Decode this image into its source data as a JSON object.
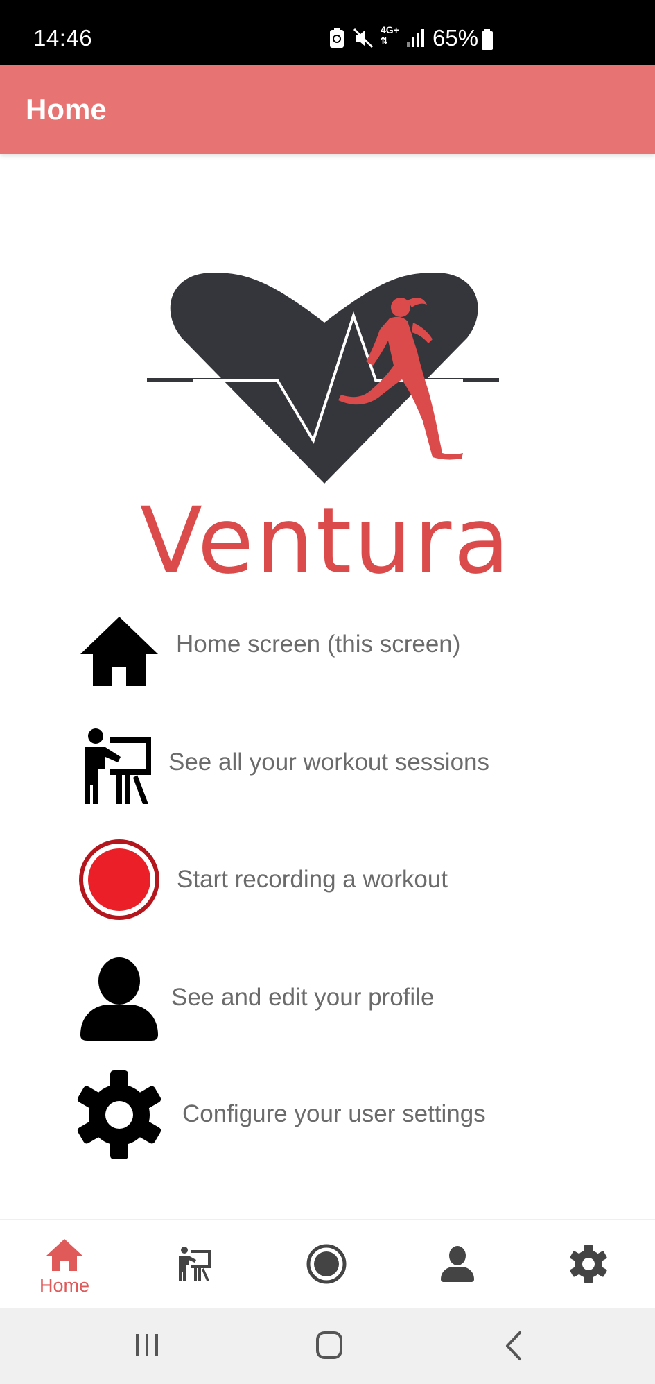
{
  "status_bar": {
    "time": "14:46",
    "network": "4G+",
    "battery": "65%"
  },
  "app_bar": {
    "title": "Home"
  },
  "logo": {
    "brand": "Ventura",
    "colors": {
      "heart": "#35363b",
      "runner": "#dc4b4b"
    }
  },
  "features": [
    {
      "icon": "home-icon",
      "label": "Home screen (this screen)"
    },
    {
      "icon": "presentation-icon",
      "label": "See all your workout sessions"
    },
    {
      "icon": "record-icon",
      "label": "Start recording a workout"
    },
    {
      "icon": "person-icon",
      "label": "See and edit your profile"
    },
    {
      "icon": "gear-icon",
      "label": "Configure your user settings"
    }
  ],
  "bottom_nav": {
    "active": "Home",
    "items": [
      {
        "icon": "home-icon",
        "label": "Home"
      },
      {
        "icon": "presentation-icon",
        "label": ""
      },
      {
        "icon": "record-icon",
        "label": ""
      },
      {
        "icon": "person-icon",
        "label": ""
      },
      {
        "icon": "gear-icon",
        "label": ""
      }
    ]
  },
  "system_nav": {
    "buttons": [
      "recents-icon",
      "home-circle-icon",
      "back-icon"
    ]
  },
  "colors": {
    "accent": "#e87373",
    "active_nav": "#e05a5a",
    "inactive_nav": "#444444",
    "record_red": "#ea1f27"
  }
}
